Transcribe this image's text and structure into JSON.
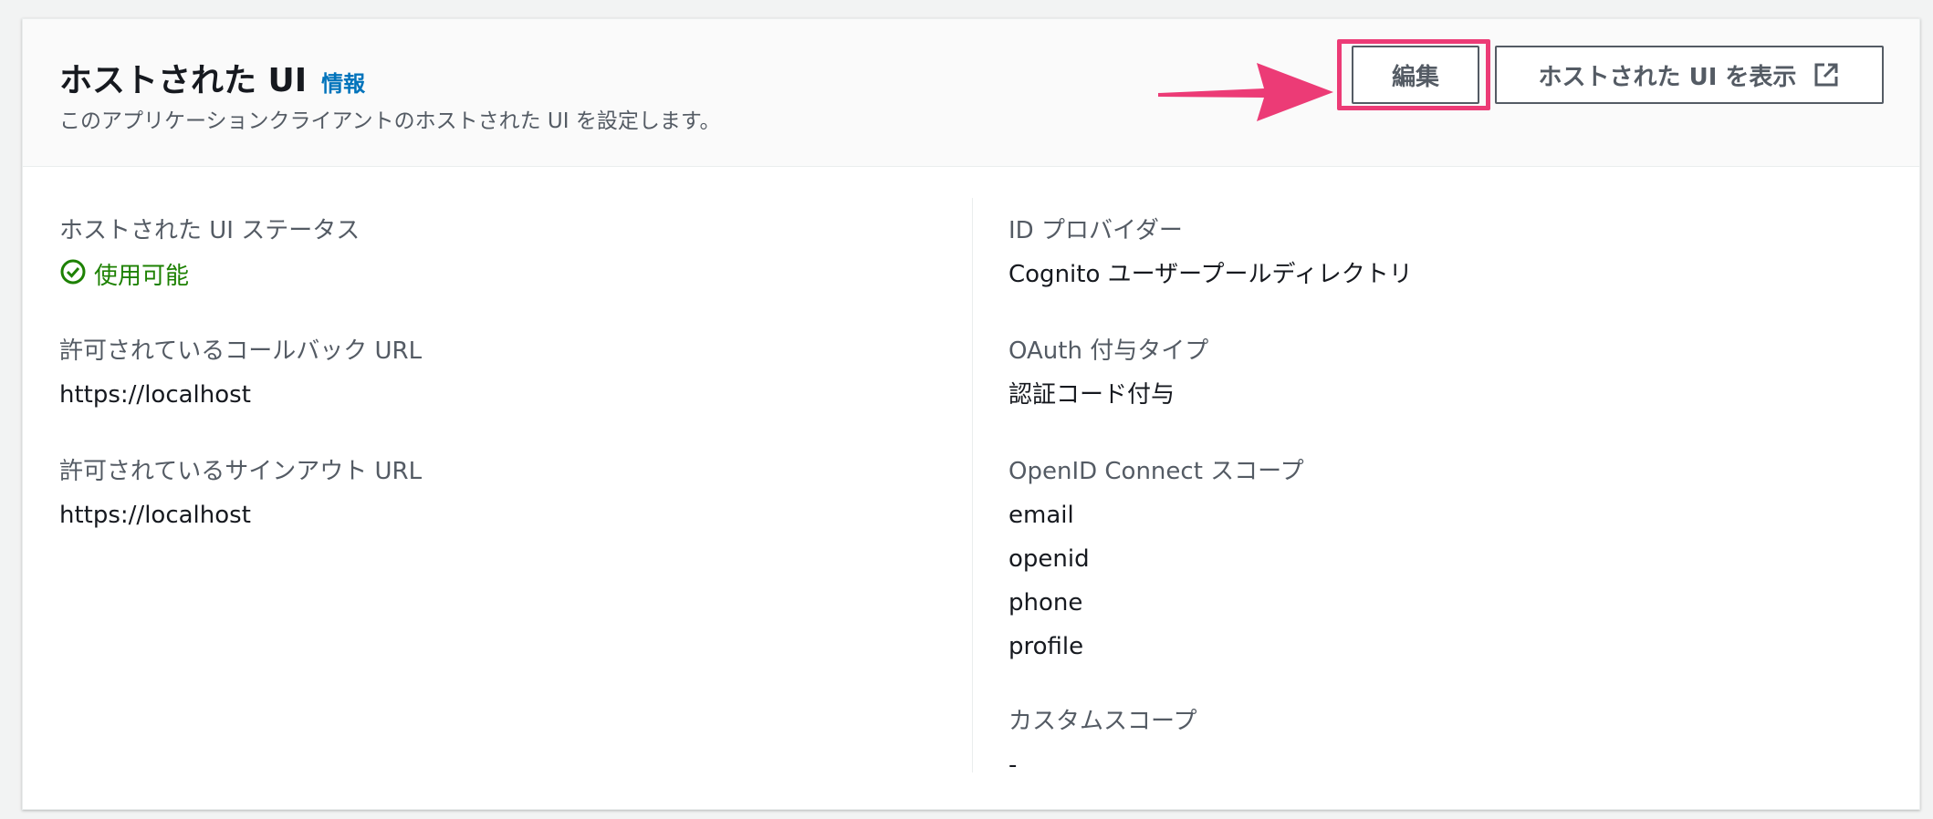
{
  "header": {
    "title": "ホストされた UI",
    "info_link": "情報",
    "description": "このアプリケーションクライアントのホストされた UI を設定します。",
    "edit_button": "編集",
    "view_button": "ホストされた UI を表示"
  },
  "left": {
    "status": {
      "label": "ホストされた UI ステータス",
      "value": "使用可能"
    },
    "callback": {
      "label": "許可されているコールバック URL",
      "value": "https://localhost"
    },
    "signout": {
      "label": "許可されているサインアウト URL",
      "value": "https://localhost"
    }
  },
  "right": {
    "idp": {
      "label": "ID プロバイダー",
      "value": "Cognito ユーザープールディレクトリ"
    },
    "grant": {
      "label": "OAuth 付与タイプ",
      "value": "認証コード付与"
    },
    "scopes": {
      "label": "OpenID Connect スコープ",
      "values": [
        "email",
        "openid",
        "phone",
        "profile"
      ]
    },
    "custom": {
      "label": "カスタムスコープ",
      "value": "-"
    }
  },
  "colors": {
    "accent_link": "#0073bb",
    "status_green": "#1d8102",
    "highlight_pink": "#ec3b76"
  },
  "icons": [
    "check-circle-icon",
    "external-link-icon",
    "annotation-arrow"
  ]
}
